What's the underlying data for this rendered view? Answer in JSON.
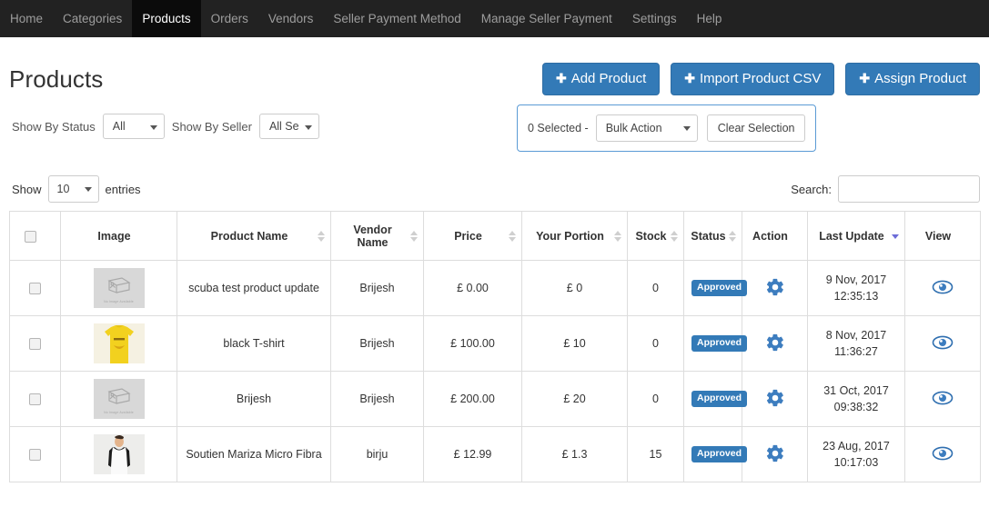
{
  "nav": {
    "items": [
      {
        "label": "Home",
        "active": false
      },
      {
        "label": "Categories",
        "active": false
      },
      {
        "label": "Products",
        "active": true
      },
      {
        "label": "Orders",
        "active": false
      },
      {
        "label": "Vendors",
        "active": false
      },
      {
        "label": "Seller Payment Method",
        "active": false
      },
      {
        "label": "Manage Seller Payment",
        "active": false
      },
      {
        "label": "Settings",
        "active": false
      },
      {
        "label": "Help",
        "active": false
      }
    ]
  },
  "header": {
    "title": "Products",
    "buttons": [
      {
        "label": "Add Product",
        "icon": "plus-icon"
      },
      {
        "label": "Import Product CSV",
        "icon": "plus-icon"
      },
      {
        "label": "Assign Product",
        "icon": "plus-icon"
      }
    ]
  },
  "filters": {
    "status_label": "Show By Status",
    "status_value": "All",
    "seller_label": "Show By Seller",
    "seller_value": "All Se"
  },
  "bulk": {
    "selected_text": "0 Selected -",
    "action_value": "Bulk Action",
    "clear_label": "Clear Selection"
  },
  "controls": {
    "show_label": "Show",
    "entries_value": "10",
    "entries_label": "entries",
    "search_label": "Search:",
    "search_value": "",
    "search_placeholder": ""
  },
  "table": {
    "columns": [
      {
        "label": "",
        "sort": "none"
      },
      {
        "label": "Image",
        "sort": "none"
      },
      {
        "label": "Product Name",
        "sort": "both"
      },
      {
        "label": "Vendor Name",
        "sort": "both"
      },
      {
        "label": "Price",
        "sort": "both"
      },
      {
        "label": "Your Portion",
        "sort": "both"
      },
      {
        "label": "Stock",
        "sort": "both"
      },
      {
        "label": "Status",
        "sort": "both"
      },
      {
        "label": "Action",
        "sort": "none"
      },
      {
        "label": "Last Update",
        "sort": "desc"
      },
      {
        "label": "View",
        "sort": "none"
      }
    ],
    "rows": [
      {
        "image": "no-image-placeholder",
        "placeholder_text": "No Image Available",
        "name": "scuba test product update",
        "vendor": "Brijesh",
        "price": "£ 0.00",
        "portion": "£ 0",
        "stock": "0",
        "status": "Approved",
        "date": "9 Nov, 2017",
        "time": "12:35:13"
      },
      {
        "image": "yellow-tshirt-photo",
        "placeholder_text": "",
        "name": "black T-shirt",
        "vendor": "Brijesh",
        "price": "£ 100.00",
        "portion": "£ 10",
        "stock": "0",
        "status": "Approved",
        "date": "8 Nov, 2017",
        "time": "11:36:27"
      },
      {
        "image": "no-image-placeholder",
        "placeholder_text": "No Image Available",
        "name": "Brijesh",
        "vendor": "Brijesh",
        "price": "£ 200.00",
        "portion": "£ 20",
        "stock": "0",
        "status": "Approved",
        "date": "31 Oct, 2017",
        "time": "09:38:32"
      },
      {
        "image": "model-raglan-photo",
        "placeholder_text": "",
        "name": "Soutien Mariza Micro Fibra",
        "vendor": "birju",
        "price": "£ 12.99",
        "portion": "£ 1.3",
        "stock": "15",
        "status": "Approved",
        "date": "23 Aug, 2017",
        "time": "10:17:03"
      }
    ]
  },
  "colors": {
    "navbar": "#222222",
    "nav_active": "#0b0b0b",
    "primary": "#337ab7",
    "badge": "#337ab7",
    "icon_blue": "#3d7dbf",
    "sort_active": "#6c6cd8",
    "border": "#dddddd"
  }
}
